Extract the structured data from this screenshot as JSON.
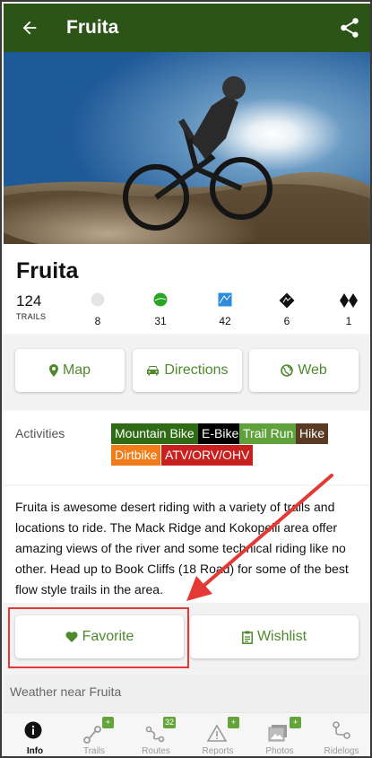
{
  "header": {
    "title": "Fruita",
    "back_icon": "arrow-left-icon",
    "share_icon": "share-icon",
    "bg_color": "#2b5416"
  },
  "hero": {
    "description_icon": "mountain-bike-photo"
  },
  "area": {
    "name": "Fruita",
    "trail_count": "124",
    "trail_count_label": "TRAILS",
    "difficulties": [
      {
        "name": "white-circle",
        "count": "8",
        "color": "#e5e5e5"
      },
      {
        "name": "green-circle",
        "count": "31",
        "color": "#2aa526"
      },
      {
        "name": "blue-square",
        "count": "42",
        "color": "#2b8bdc"
      },
      {
        "name": "black-diamond",
        "count": "6",
        "color": "#111111"
      },
      {
        "name": "double-black-diamond",
        "count": "1",
        "color": "#111111"
      }
    ]
  },
  "actions": {
    "map": "Map",
    "directions": "Directions",
    "web": "Web",
    "accent": "#4e8a2c"
  },
  "activities": {
    "label": "Activities",
    "tags": [
      {
        "label": "Mountain Bike",
        "color": "#2e6b14"
      },
      {
        "label": "E-Bike",
        "color": "#000000"
      },
      {
        "label": "Trail Run",
        "color": "#5fa23c"
      },
      {
        "label": "Hike",
        "color": "#5a3a22"
      },
      {
        "label": "Dirtbike",
        "color": "#f07d1a"
      },
      {
        "label": "ATV/ORV/OHV",
        "color": "#c8201e"
      }
    ]
  },
  "description": "Fruita is awesome desert riding with a variety of trails and locations to ride. The Mack Ridge and Kokopelli area offer amazing views of the river and some technical riding like no other. Head up to Book Cliffs (18 Road) for some of the best flow style trails in the area.",
  "favorites": {
    "favorite": "Favorite",
    "wishlist": "Wishlist"
  },
  "weather": {
    "label": "Weather near Fruita"
  },
  "nav": {
    "items": [
      {
        "label": "Info",
        "icon": "info-icon",
        "badge": ""
      },
      {
        "label": "Trails",
        "icon": "trails-icon",
        "badge": "+"
      },
      {
        "label": "Routes",
        "icon": "routes-icon",
        "badge": "32"
      },
      {
        "label": "Reports",
        "icon": "reports-icon",
        "badge": "+"
      },
      {
        "label": "Photos",
        "icon": "photos-icon",
        "badge": "+"
      },
      {
        "label": "Ridelogs",
        "icon": "ridelogs-icon",
        "badge": ""
      }
    ]
  },
  "annotation": {
    "highlight_color": "#e53935"
  }
}
